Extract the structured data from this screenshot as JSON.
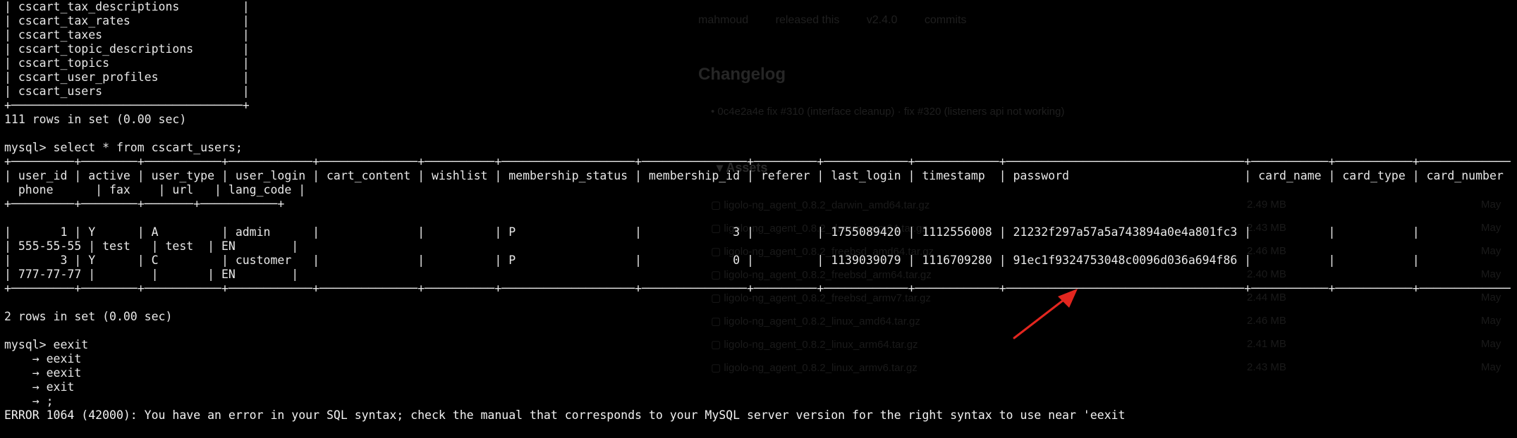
{
  "background_page": {
    "topbar": [
      "mahmoud",
      "released this",
      "v2.4.0",
      "commits"
    ],
    "heading": "Changelog",
    "changelog_line": "• 0c4e2a4e  fix #310 (interface cleanup) · fix #320 (listeners api not working)",
    "assets_label": "▾ Assets",
    "asset_rows": [
      {
        "name": "ligolo-ng_agent_0.8.2_darwin_amd64.tar.gz",
        "size": "2.49 MB",
        "date": "May"
      },
      {
        "name": "ligolo-ng_agent_0.8.2_darwin_arm64.tar.gz",
        "size": "2.43 MB",
        "date": "May"
      },
      {
        "name": "ligolo-ng_agent_0.8.2_freebsd_amd64.tar.gz",
        "size": "2.46 MB",
        "date": "May"
      },
      {
        "name": "ligolo-ng_agent_0.8.2_freebsd_arm64.tar.gz",
        "size": "2.40 MB",
        "date": "May"
      },
      {
        "name": "ligolo-ng_agent_0.8.2_freebsd_armv7.tar.gz",
        "size": "2.44 MB",
        "date": "May"
      },
      {
        "name": "ligolo-ng_agent_0.8.2_linux_amd64.tar.gz",
        "size": "2.46 MB",
        "date": "May"
      },
      {
        "name": "ligolo-ng_agent_0.8.2_linux_arm64.tar.gz",
        "size": "2.41 MB",
        "date": "May"
      },
      {
        "name": "ligolo-ng_agent_0.8.2_linux_armv6.tar.gz",
        "size": "2.43 MB",
        "date": "May"
      }
    ]
  },
  "terminal": {
    "lines": [
      "| cscart_tax_descriptions         |",
      "| cscart_tax_rates                |",
      "| cscart_taxes                    |",
      "| cscart_topic_descriptions       |",
      "| cscart_topics                   |",
      "| cscart_user_profiles            |",
      "| cscart_users                    |",
      "+─────────────────────────────────+",
      "111 rows in set (0.00 sec)",
      "",
      "mysql> select * from cscart_users;",
      "+─────────+────────+───────────+────────────+──────────────+──────────+───────────────────+───────────────+─────────+────────────+────────────+──────────────────────────────────+───────────+───────────+─────────────",
      "| user_id | active | user_type | user_login | cart_content | wishlist | membership_status | membership_id | referer | last_login | timestamp  | password                         | card_name | card_type | card_number",
      "  phone      | fax    | url   | lang_code |",
      "+─────────+────────+───────+───────────+",
      "",
      "|       1 | Y      | A         | admin      |              |          | P                 |             3 |         | 1755089420 | 1112556008 | 21232f297a57a5a743894a0e4a801fc3 |           |           |",
      "| 555-55-55 | test   | test  | EN        |",
      "|       3 | Y      | C         | customer   |              |          | P                 |             0 |         | 1139039079 | 1116709280 | 91ec1f9324753048c0096d036a694f86 |           |           |",
      "| 777-77-77 |        |       | EN        |",
      "+─────────+────────+───────────+────────────+──────────────+──────────+───────────────────+───────────────+─────────+────────────+────────────+──────────────────────────────────+───────────+───────────+─────────────",
      "",
      "2 rows in set (0.00 sec)",
      "",
      "mysql> eexit",
      "    → eexit",
      "    → eexit",
      "    → exit",
      "    → ;",
      "ERROR 1064 (42000): You have an error in your SQL syntax; check the manual that corresponds to your MySQL server version for the right syntax to use near 'eexit"
    ]
  },
  "annotation": {
    "arrow_color": "#e3261f",
    "points_to": "password hash"
  }
}
